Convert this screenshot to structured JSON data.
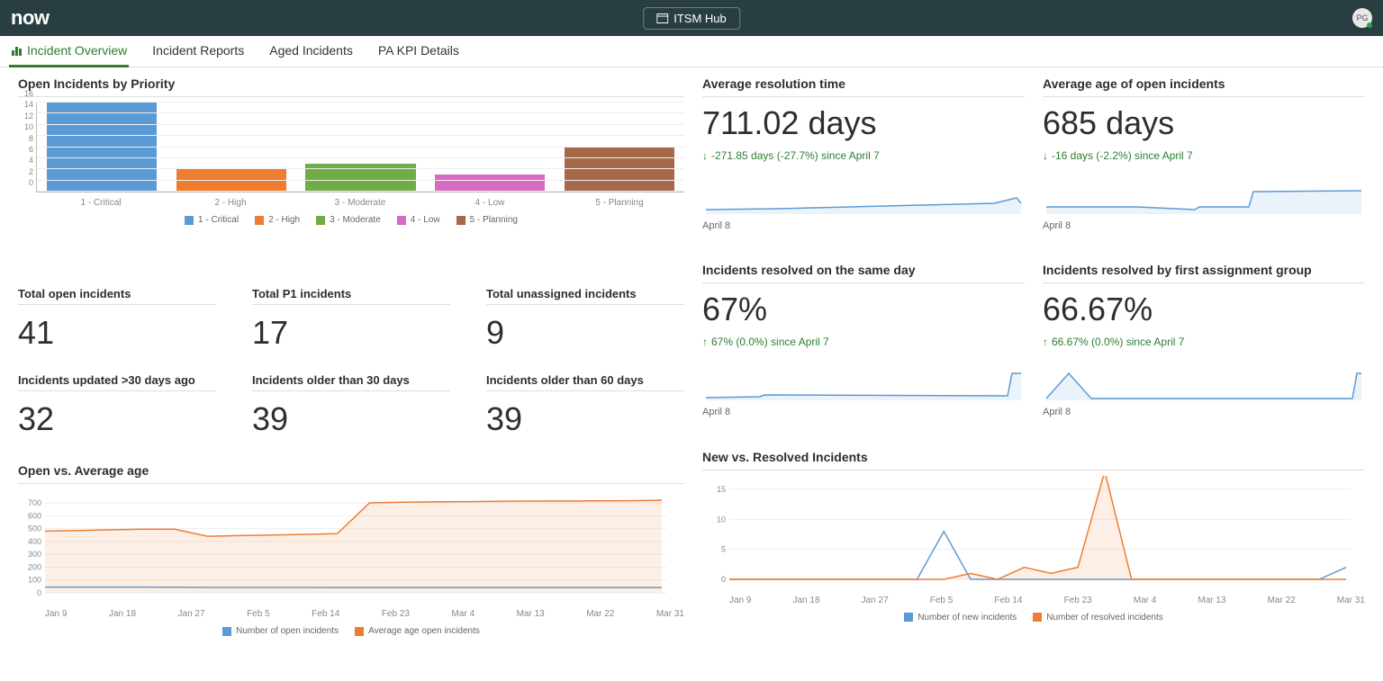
{
  "header": {
    "logo": "now",
    "hub_label": "ITSM Hub",
    "avatar_initials": "PG"
  },
  "tabs": [
    {
      "label": "Incident Overview",
      "active": true
    },
    {
      "label": "Incident Reports",
      "active": false
    },
    {
      "label": "Aged Incidents",
      "active": false
    },
    {
      "label": "PA KPI Details",
      "active": false
    }
  ],
  "chart_data": [
    {
      "id": "priority_bar",
      "title": "Open Incidents by Priority",
      "type": "bar",
      "categories": [
        "1 - Critical",
        "2 - High",
        "3 - Moderate",
        "4 - Low",
        "5 - Planning"
      ],
      "values": [
        16,
        4,
        5,
        3,
        8
      ],
      "colors": [
        "#5b9bd5",
        "#ed7d31",
        "#70ad47",
        "#d76bc2",
        "#a5694a"
      ],
      "yticks": [
        0,
        2,
        4,
        6,
        8,
        10,
        12,
        14,
        16
      ],
      "legend": [
        "1 - Critical",
        "2 - High",
        "3 - Moderate",
        "4 - Low",
        "5 - Planning"
      ]
    },
    {
      "id": "open_vs_age",
      "title": "Open vs. Average age",
      "type": "line",
      "yticks": [
        0,
        100,
        200,
        300,
        400,
        500,
        600,
        700
      ],
      "xticks": [
        "Jan 9",
        "Jan 18",
        "Jan 27",
        "Feb 5",
        "Feb 14",
        "Feb 23",
        "Mar 4",
        "Mar 13",
        "Mar 22",
        "Mar 31"
      ],
      "series": [
        {
          "name": "Number of open incidents",
          "color": "#5b9bd5",
          "values": [
            45,
            45,
            45,
            45,
            44,
            42,
            42,
            42,
            42,
            41,
            41,
            41,
            41,
            41,
            41,
            41,
            41,
            41,
            41,
            41
          ]
        },
        {
          "name": "Average age open incidents",
          "color": "#ed7d31",
          "values": [
            480,
            485,
            490,
            495,
            495,
            440,
            445,
            450,
            455,
            460,
            700,
            705,
            708,
            710,
            712,
            714,
            715,
            716,
            717,
            720
          ]
        }
      ]
    },
    {
      "id": "new_vs_resolved",
      "title": "New vs. Resolved Incidents",
      "type": "line",
      "yticks": [
        0,
        5,
        10,
        15
      ],
      "xticks": [
        "Jan 9",
        "Jan 18",
        "Jan 27",
        "Feb 5",
        "Feb 14",
        "Feb 23",
        "Mar 4",
        "Mar 13",
        "Mar 22",
        "Mar 31"
      ],
      "series": [
        {
          "name": "Number of new incidents",
          "color": "#5b9bd5",
          "values": [
            0,
            0,
            0,
            0,
            0,
            0,
            0,
            0,
            8,
            0,
            0,
            0,
            0,
            0,
            0,
            0,
            0,
            0,
            0,
            0,
            0,
            0,
            0,
            2
          ]
        },
        {
          "name": "Number of resolved incidents",
          "color": "#ed7d31",
          "values": [
            0,
            0,
            0,
            0,
            0,
            0,
            0,
            0,
            0,
            1,
            0,
            2,
            1,
            2,
            18,
            0,
            0,
            0,
            0,
            0,
            0,
            0,
            0,
            0
          ]
        }
      ]
    }
  ],
  "scorecards": [
    {
      "title": "Total open incidents",
      "value": "41"
    },
    {
      "title": "Total P1 incidents",
      "value": "17"
    },
    {
      "title": "Total unassigned incidents",
      "value": "9"
    },
    {
      "title": "Incidents updated >30 days ago",
      "value": "32"
    },
    {
      "title": "Incidents older than 30 days",
      "value": "39"
    },
    {
      "title": "Incidents older than 60 days",
      "value": "39"
    }
  ],
  "kpis": [
    {
      "title": "Average resolution time",
      "value": "711.02 days",
      "change": "-271.85 days (-27.7%) since April 7",
      "direction": "down",
      "date": "April 8"
    },
    {
      "title": "Average age of open incidents",
      "value": "685 days",
      "change": "-16 days (-2.2%) since April 7",
      "direction": "down",
      "date": "April 8"
    },
    {
      "title": "Incidents resolved on the same day",
      "value": "67%",
      "change": "67% (0.0%) since April 7",
      "direction": "up",
      "date": "April 8"
    },
    {
      "title": "Incidents resolved by first assignment group",
      "value": "66.67%",
      "change": "66.67% (0.0%) since April 7",
      "direction": "up",
      "date": "April 8"
    }
  ],
  "sparklines": {
    "k0": "0,35 80,34 160,32 240,30 320,28 345,22 350,28",
    "k1": "0,32 100,32 165,35 170,32 225,32 230,15 350,14",
    "k2": "0,37 60,36 65,34 335,35 340,10 350,10",
    "k3": "0,38 25,10 50,38 340,38 345,10 350,10"
  }
}
